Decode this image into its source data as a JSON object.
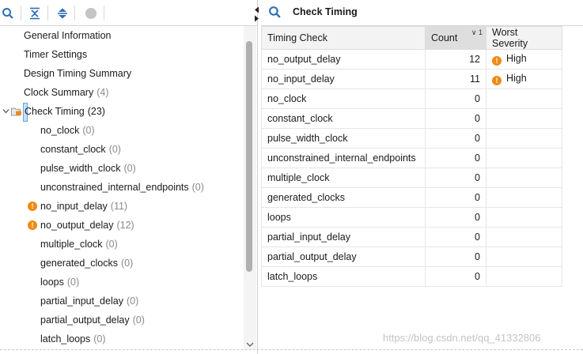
{
  "toolbar": {
    "icons": [
      "search-icon",
      "collapse-all-icon",
      "expand-all-icon",
      "stop-icon"
    ]
  },
  "tree": {
    "items": [
      {
        "label": "General Information",
        "count": ""
      },
      {
        "label": "Timer Settings",
        "count": ""
      },
      {
        "label": "Design Timing Summary",
        "count": ""
      },
      {
        "label": "Clock Summary",
        "count": "(4)"
      },
      {
        "label": "Check Timing",
        "count": "(23)",
        "selected": true,
        "expanded": true
      },
      {
        "label": "no_clock",
        "count": "(0)"
      },
      {
        "label": "constant_clock",
        "count": "(0)"
      },
      {
        "label": "pulse_width_clock",
        "count": "(0)"
      },
      {
        "label": "unconstrained_internal_endpoints",
        "count": "(0)"
      },
      {
        "label": "no_input_delay",
        "count": "(11)",
        "warning": true
      },
      {
        "label": "no_output_delay",
        "count": "(12)",
        "warning": true
      },
      {
        "label": "multiple_clock",
        "count": "(0)"
      },
      {
        "label": "generated_clocks",
        "count": "(0)"
      },
      {
        "label": "loops",
        "count": "(0)"
      },
      {
        "label": "partial_input_delay",
        "count": "(0)"
      },
      {
        "label": "partial_output_delay",
        "count": "(0)"
      },
      {
        "label": "latch_loops",
        "count": "(0)"
      }
    ]
  },
  "panel": {
    "title": "Check Timing"
  },
  "table": {
    "headers": {
      "check": "Timing Check",
      "count": "Count",
      "severity": "Worst Severity"
    },
    "sort_indicator": "1",
    "rows": [
      {
        "check": "no_output_delay",
        "count": "12",
        "severity": "High"
      },
      {
        "check": "no_input_delay",
        "count": "11",
        "severity": "High"
      },
      {
        "check": "no_clock",
        "count": "0",
        "severity": ""
      },
      {
        "check": "constant_clock",
        "count": "0",
        "severity": ""
      },
      {
        "check": "pulse_width_clock",
        "count": "0",
        "severity": ""
      },
      {
        "check": "unconstrained_internal_endpoints",
        "count": "0",
        "severity": ""
      },
      {
        "check": "multiple_clock",
        "count": "0",
        "severity": ""
      },
      {
        "check": "generated_clocks",
        "count": "0",
        "severity": ""
      },
      {
        "check": "loops",
        "count": "0",
        "severity": ""
      },
      {
        "check": "partial_input_delay",
        "count": "0",
        "severity": ""
      },
      {
        "check": "partial_output_delay",
        "count": "0",
        "severity": ""
      },
      {
        "check": "latch_loops",
        "count": "0",
        "severity": ""
      }
    ]
  },
  "colors": {
    "warning": "#ef8a14",
    "selection_bg": "#c8dff7",
    "selection_border": "#6ba3e0",
    "icon_blue": "#2f6fb5"
  },
  "watermark": "https://blog.csdn.net/qq_41332806"
}
